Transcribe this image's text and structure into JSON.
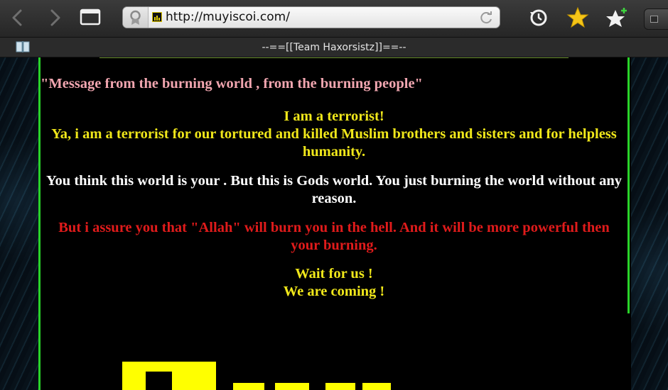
{
  "browser": {
    "url": "http://muyiscoi.com/",
    "page_title": "--==[[Team Haxorsistz]]==--",
    "icons": [
      "back-icon",
      "forward-icon",
      "tabs-icon",
      "site-info-icon",
      "favicon",
      "reload-icon",
      "history-icon",
      "bookmark-star-icon",
      "add-bookmark-icon",
      "window-button",
      "reader-book-icon"
    ]
  },
  "page": {
    "quote": "\"Message from the burning world , from the burning people\"",
    "terrorist_line1": "I am a terrorist!",
    "terrorist_line2": "Ya, i am a terrorist for our tortured and killed Muslim brothers and sisters and for helpless humanity.",
    "world_line": "You think this world is your . But this is Gods world. You just burning the world without any reason.",
    "assure_line": "But i assure you that \"Allah\" will burn you in the hell. And it will be more powerful then your burning.",
    "wait_line": "Wait for us !",
    "coming_line": "We are coming !"
  },
  "colors": {
    "yellow_text": "#f0e71a",
    "white_text": "#ffffff",
    "red_text": "#e01b1b",
    "pink_text": "#f1a6b0",
    "green_border": "#29d329",
    "logo_yellow": "#ffff00"
  }
}
